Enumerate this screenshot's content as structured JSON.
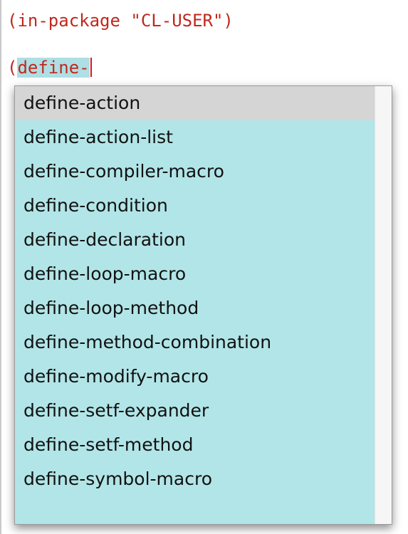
{
  "editor": {
    "line1": "(in-package \"CL-USER\")",
    "line2_prefix": "(",
    "line2_typed": "define-"
  },
  "completion": {
    "selected_index": 0,
    "items": [
      "define-action",
      "define-action-list",
      "define-compiler-macro",
      "define-condition",
      "define-declaration",
      "define-loop-macro",
      "define-loop-method",
      "define-method-combination",
      "define-modify-macro",
      "define-setf-expander",
      "define-setf-method",
      "define-symbol-macro"
    ]
  },
  "colors": {
    "code_text": "#c0281e",
    "typed_highlight": "#aedfe4",
    "caret": "#e0141e",
    "popup_background": "#b2e5e8",
    "selected_item": "#d5d5d5"
  }
}
